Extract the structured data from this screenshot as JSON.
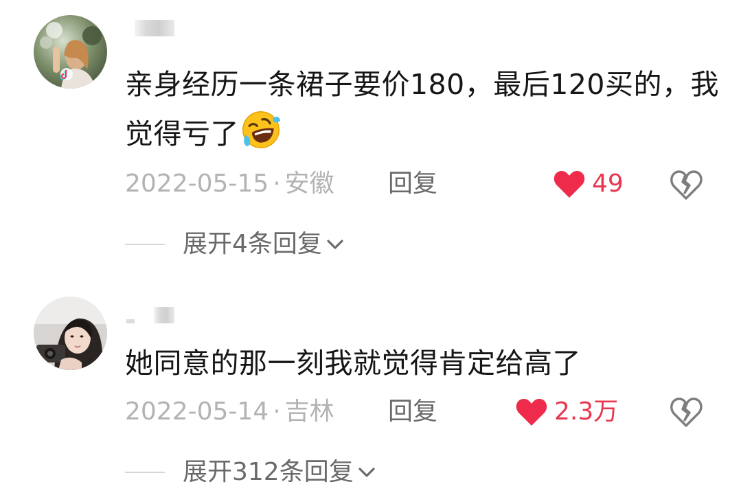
{
  "comments": [
    {
      "text": "亲身经历一条裙子要价180，最后120买的，我觉得亏了",
      "emoji": "rolling-on-floor-laughing-emoji",
      "date": "2022-05-15",
      "location": "安徽",
      "separator": "·",
      "reply_label": "回复",
      "likes": "49",
      "expand_label": "展开4条回复"
    },
    {
      "text": "她同意的那一刻我就觉得肯定给高了",
      "date": "2022-05-14",
      "location": "吉林",
      "separator": "·",
      "reply_label": "回复",
      "likes": "2.3万",
      "expand_label": "展开312条回复"
    }
  ],
  "colors": {
    "heart": "#ee2b4b",
    "like_count": "#e8364f",
    "meta_text": "#b3b3b3",
    "body_text": "#161616",
    "secondary_text": "#6a6a6a"
  }
}
